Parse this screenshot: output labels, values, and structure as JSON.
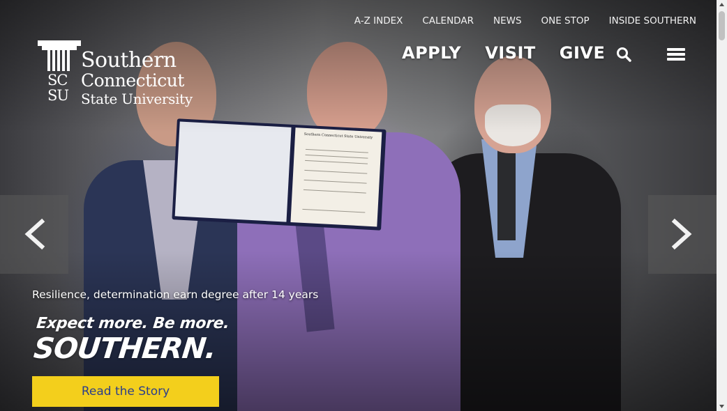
{
  "utility_nav": {
    "items": [
      "A-Z INDEX",
      "CALENDAR",
      "NEWS",
      "ONE STOP",
      "INSIDE SOUTHERN"
    ]
  },
  "logo": {
    "monogram_top": "SC",
    "monogram_bottom": "SU",
    "line1": "Southern",
    "line2": "Connecticut",
    "line3": "State University"
  },
  "main_nav": {
    "items": [
      "APPLY",
      "VISIT",
      "GIVE"
    ],
    "search_icon": "search-icon",
    "menu_icon": "hamburger-menu-icon"
  },
  "hero": {
    "caption": "Resilience, determination earn degree after 14 years",
    "tagline_line1": "Expect more. Be more.",
    "tagline_line2": "SOUTHERN.",
    "cta_label": "Read the Story",
    "diploma_title": "Southern Connecticut State University",
    "prev_icon": "chevron-left-icon",
    "next_icon": "chevron-right-icon"
  },
  "colors": {
    "cta_background": "#f3cf1c",
    "cta_text": "#2b3e8c",
    "nav_text": "#ffffff"
  }
}
